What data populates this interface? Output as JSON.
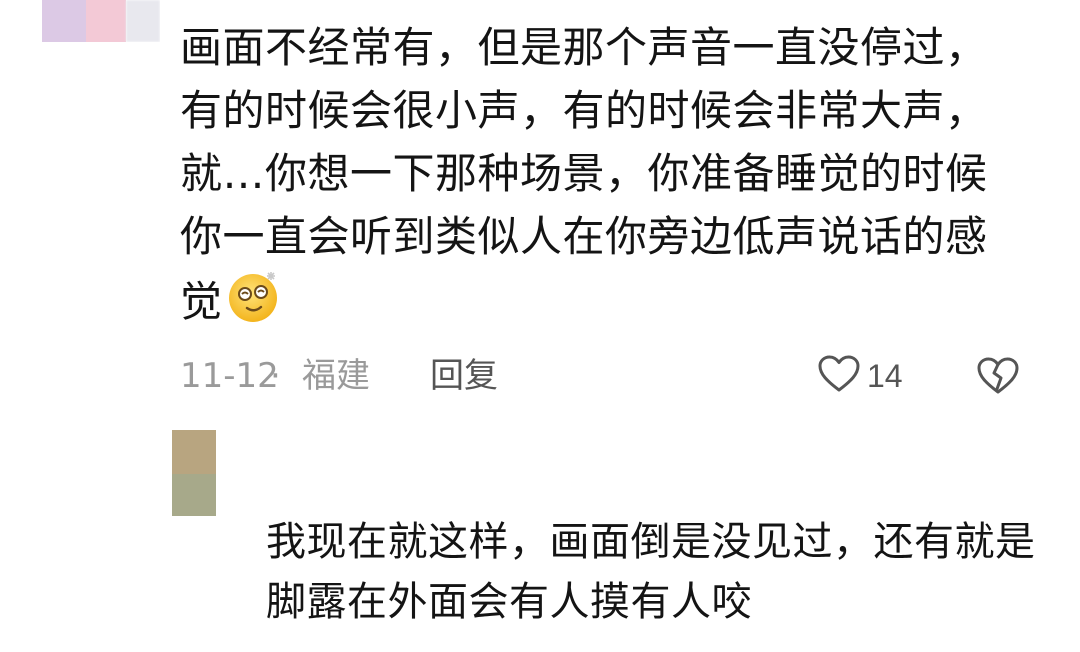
{
  "comments": [
    {
      "text": "画面不经常有，但是那个声音一直没停过，有的时候会很小声，有的时候会非常大声，就…你想一下那种场景，你准备睡觉的时候你一直会听到类似人在你旁边低声说话的感觉",
      "emoji_icon": "dizzy-face-emoji",
      "date": "11-12",
      "separator": "·",
      "location": "福建",
      "reply_label": "回复",
      "like_count": "14",
      "like_icon": "heart-outline-icon",
      "dislike_icon": "broken-heart-icon"
    },
    {
      "text": "我现在就这样，画面倒是没见过，还有就是脚露在外面会有人摸有人咬"
    }
  ],
  "colors": {
    "text": "#141414",
    "meta": "#9a9a9a",
    "action": "#555555"
  }
}
